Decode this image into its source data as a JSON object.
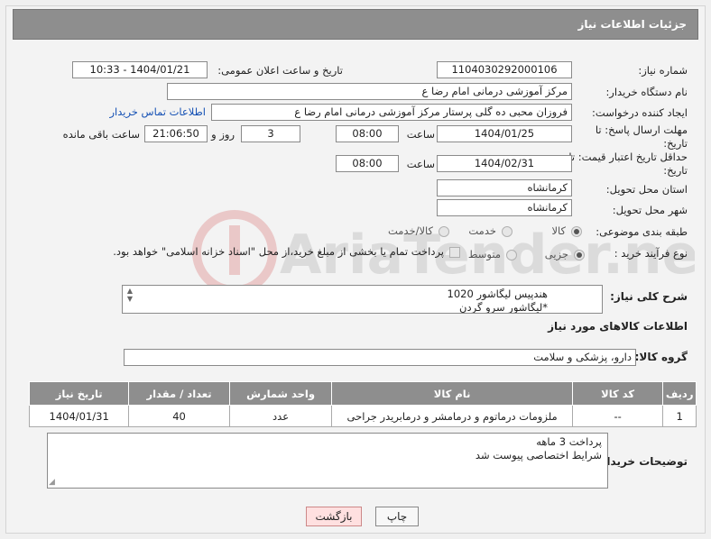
{
  "header": {
    "title": "جزئیات اطلاعات نیاز"
  },
  "fields": {
    "need_number": {
      "label": "شماره نیاز:",
      "value": "1104030292000106"
    },
    "announce_datetime": {
      "label": "تاریخ و ساعت اعلان عمومی:",
      "value": "1404/01/21 - 10:33"
    },
    "buyer_org": {
      "label": "نام دستگاه خریدار:",
      "value": "مرکز آموزشی  درمانی امام رضا  ع"
    },
    "requester": {
      "label": "ایجاد کننده درخواست:",
      "value": "فروزان محبی ده گلی پرستار مرکز آموزشی  درمانی امام رضا  ع",
      "link": "اطلاعات تماس خریدار"
    },
    "reply_deadline": {
      "label": "مهلت ارسال پاسخ: تا تاریخ:",
      "date": "1404/01/25",
      "time_label": "ساعت",
      "time": "08:00",
      "days": "3",
      "days_label": "روز و",
      "remaining": "21:06:50",
      "remaining_label": "ساعت باقی مانده"
    },
    "price_validity": {
      "label": "حداقل تاریخ اعتبار قیمت: تا تاریخ:",
      "date": "1404/02/31",
      "time_label": "ساعت",
      "time": "08:00"
    },
    "delivery_province": {
      "label": "استان محل تحویل:",
      "value": "کرمانشاه"
    },
    "delivery_city": {
      "label": "شهر محل تحویل:",
      "value": "کرمانشاه"
    },
    "category": {
      "label": "طبقه بندی موضوعی:",
      "options": [
        "کالا",
        "خدمت",
        "کالا/خدمت"
      ],
      "selected": "کالا"
    },
    "process": {
      "label": "نوع فرآیند خرید :",
      "options": [
        "جزیی",
        "متوسط"
      ],
      "selected": "جزیی",
      "note": "پرداخت تمام یا بخشی از مبلغ خرید،از محل \"اسناد خزانه اسلامی\" خواهد بود."
    }
  },
  "summary": {
    "label": "شرح کلی نیاز:",
    "text": "هندپیس لیگاشور  1020\n*لیگاشور سرو گردن"
  },
  "goods_section": {
    "title": "اطلاعات کالاهای مورد نیاز",
    "group_label": "گروه کالا:",
    "group_value": "دارو، پزشکی و سلامت"
  },
  "table": {
    "headers": [
      "ردیف",
      "کد کالا",
      "نام کالا",
      "واحد شمارش",
      "تعداد / مقدار",
      "تاریخ نیاز"
    ],
    "rows": [
      [
        "1",
        "--",
        "ملزومات درماتوم و درمامشر و درمابریدر جراحی",
        "عدد",
        "40",
        "1404/01/31"
      ]
    ]
  },
  "buyer_notes": {
    "label": "توضیحات خریدار:",
    "text": "پرداخت 3 ماهه\nشرایط اختصاصی پیوست شد"
  },
  "buttons": {
    "print": "چاپ",
    "back": "بازگشت"
  },
  "watermark_text": "AriaTender.net"
}
